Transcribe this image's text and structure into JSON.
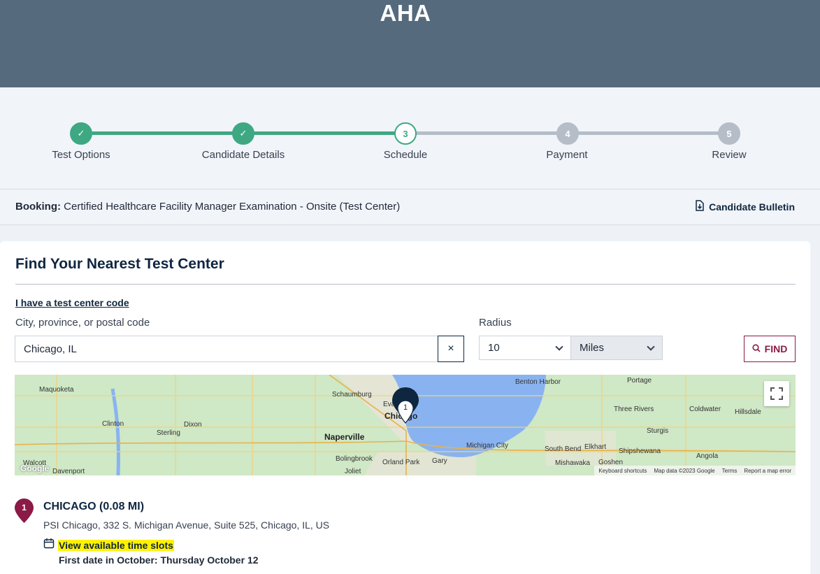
{
  "header": {
    "title": "AHA"
  },
  "stepper": {
    "steps": [
      {
        "number": "1",
        "label": "Test Options",
        "state": "done"
      },
      {
        "number": "2",
        "label": "Candidate Details",
        "state": "done"
      },
      {
        "number": "3",
        "label": "Schedule",
        "state": "current"
      },
      {
        "number": "4",
        "label": "Payment",
        "state": "todo"
      },
      {
        "number": "5",
        "label": "Review",
        "state": "todo"
      }
    ],
    "check_glyph": "✓",
    "colors": {
      "done": "#3ea883",
      "todo": "#b5bdc8"
    }
  },
  "booking": {
    "label": "Booking:",
    "value": "Certified Healthcare Facility Manager Examination - Onsite (Test Center)",
    "bulletin_label": "Candidate Bulletin"
  },
  "finder": {
    "title": "Find Your Nearest Test Center",
    "code_link": "I have a test center code",
    "city_label": "City, province, or postal code",
    "city_value": "Chicago, IL",
    "clear_glyph": "×",
    "radius_label": "Radius",
    "radius_value": "10",
    "unit_value": "Miles",
    "find_label": "FIND"
  },
  "map": {
    "labels": {
      "maquoketa": "Maquoketa",
      "clinton": "Clinton",
      "dixon": "Dixon",
      "sterling": "Sterling",
      "schaumburg": "Schaumburg",
      "evanston": "Eva",
      "chicago": "Chicago",
      "naperville": "Naperville",
      "bolingbrook": "Bolingbrook",
      "orland_park": "Orland Park",
      "gary": "Gary",
      "joliet": "Joliet",
      "walcott": "Walcott",
      "davenport": "Davenport",
      "benton_harbor": "Benton Harbor",
      "portage": "Portage",
      "three_rivers": "Three Rivers",
      "coldwater": "Coldwater",
      "hillsdale": "Hillsdale",
      "sturgis": "Sturgis",
      "michigan_city": "Michigan City",
      "south_bend": "South Bend",
      "elkhart": "Elkhart",
      "shipshewana": "Shipshewana",
      "angola": "Angola",
      "mishawaka": "Mishawaka",
      "goshen": "Goshen"
    },
    "marker_number": "1",
    "google": "Google",
    "footer": {
      "shortcuts": "Keyboard shortcuts",
      "data": "Map data ©2023 Google",
      "terms": "Terms",
      "report": "Report a map error"
    }
  },
  "result": {
    "number": "1",
    "title": "CHICAGO (0.08 MI)",
    "address": "PSI Chicago, 332 S. Michigan Avenue, Suite 525, Chicago, IL, US",
    "slots_link": "View available time slots",
    "first_date": "First date in October: Thursday October 12"
  }
}
